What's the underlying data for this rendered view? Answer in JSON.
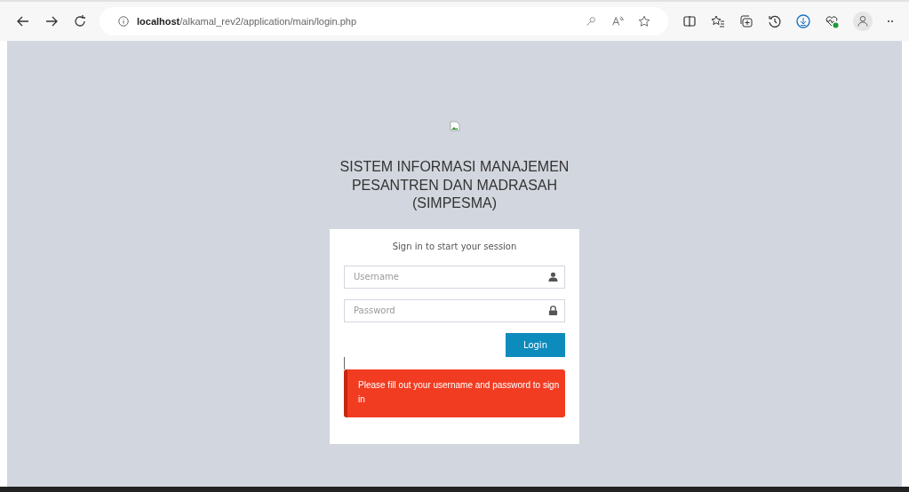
{
  "browser": {
    "url": "**localhost**/alkamal_rev2/application/main/login.php"
  },
  "page": {
    "title_lines": [
      "SISTEM INFORMASI MANAJEMEN",
      "PESANTREN DAN MADRASAH",
      "(SIMPESMA)"
    ],
    "login_box": {
      "message": "Sign in to start your session",
      "fields": [
        {
          "placeholder": "Username",
          "kind": "user"
        },
        {
          "placeholder": "Password",
          "kind": "password"
        }
      ],
      "button": "Login",
      "alert": "Please fill out your username and password to sign in"
    }
  }
}
